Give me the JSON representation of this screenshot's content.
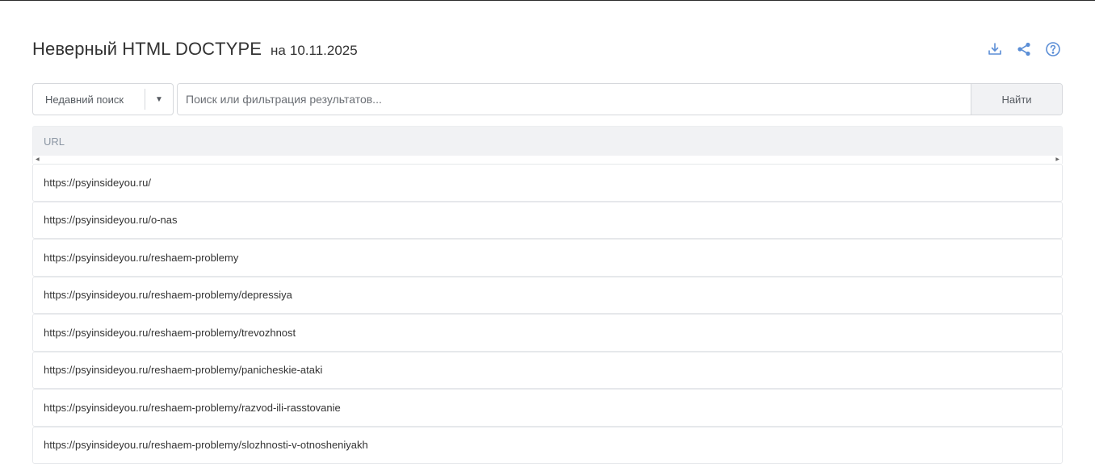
{
  "header": {
    "title": "Неверный HTML DOCTYPE",
    "date_prefix": "на",
    "date": "10.11.2025"
  },
  "actions": {
    "download_icon": "download-icon",
    "share_icon": "share-icon",
    "help_icon": "help-icon",
    "icon_color": "#5b8ed6"
  },
  "search": {
    "recent_label": "Недавний поиск",
    "placeholder": "Поиск или фильтрация результатов...",
    "find_label": "Найти"
  },
  "table": {
    "columns": [
      "URL"
    ],
    "rows": [
      "https://psyinsideyou.ru/",
      "https://psyinsideyou.ru/o-nas",
      "https://psyinsideyou.ru/reshaem-problemy",
      "https://psyinsideyou.ru/reshaem-problemy/depressiya",
      "https://psyinsideyou.ru/reshaem-problemy/trevozhnost",
      "https://psyinsideyou.ru/reshaem-problemy/panicheskie-ataki",
      "https://psyinsideyou.ru/reshaem-problemy/razvod-ili-rasstovanie",
      "https://psyinsideyou.ru/reshaem-problemy/slozhnosti-v-otnosheniyakh"
    ]
  }
}
